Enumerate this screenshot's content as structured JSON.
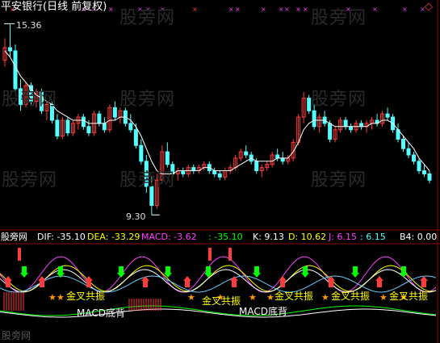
{
  "header": {
    "title": "平安银行(日线 前复权)",
    "marker": "◇"
  },
  "price": {
    "high_label": "15.36",
    "low_label": "9.30"
  },
  "watermark": "股旁网",
  "indicator_bar": {
    "label": "股旁网",
    "dif": "DIF: -35.10",
    "dea": "DEA: -33.29",
    "macd": "MACD: -3.62",
    "extra": ": -35.10",
    "k": "K: 9.13",
    "d": "D: 10.62",
    "j": "J: 6.15",
    "j2": ": 6.15",
    "b4": "B4: 0.00"
  },
  "annotations": {
    "golden_cross": "金叉共振",
    "macd_div": "MACD底背"
  },
  "footer_text": "股旁网",
  "colors": {
    "up": "#ff3c3c",
    "down": "#54ffff",
    "magenta": "#ff40ff",
    "yellow": "#ffff00",
    "green": "#00ff00",
    "orange": "#ff9900",
    "grid_red": "#8a0000"
  },
  "chart_data": {
    "type": "candlestick",
    "ohlc": [
      [
        14.2,
        14.9,
        14.0,
        14.6
      ],
      [
        14.6,
        15.36,
        14.3,
        14.5
      ],
      [
        14.5,
        14.7,
        13.2,
        13.3
      ],
      [
        13.3,
        13.6,
        12.6,
        12.8
      ],
      [
        12.8,
        13.5,
        12.7,
        13.4
      ],
      [
        13.4,
        13.5,
        12.8,
        12.9
      ],
      [
        12.9,
        13.3,
        12.7,
        13.2
      ],
      [
        13.2,
        13.3,
        12.5,
        12.6
      ],
      [
        12.6,
        12.9,
        12.3,
        12.8
      ],
      [
        12.8,
        12.9,
        12.2,
        12.3
      ],
      [
        12.3,
        12.5,
        11.7,
        11.8
      ],
      [
        11.8,
        12.4,
        11.7,
        12.3
      ],
      [
        12.3,
        12.4,
        11.8,
        11.9
      ],
      [
        11.9,
        12.3,
        11.8,
        12.2
      ],
      [
        12.2,
        12.5,
        12.0,
        12.4
      ],
      [
        12.4,
        12.5,
        12.0,
        12.1
      ],
      [
        12.1,
        12.3,
        11.8,
        11.9
      ],
      [
        11.9,
        12.6,
        11.8,
        12.5
      ],
      [
        12.5,
        12.6,
        12.1,
        12.2
      ],
      [
        12.2,
        12.4,
        11.9,
        12.0
      ],
      [
        12.0,
        12.8,
        11.9,
        12.7
      ],
      [
        12.7,
        12.9,
        12.3,
        12.4
      ],
      [
        12.4,
        12.7,
        12.2,
        12.6
      ],
      [
        12.6,
        12.7,
        12.1,
        12.2
      ],
      [
        12.2,
        12.5,
        11.9,
        12.0
      ],
      [
        12.0,
        12.2,
        11.4,
        11.5
      ],
      [
        11.5,
        11.7,
        10.9,
        11.0
      ],
      [
        11.0,
        11.2,
        10.0,
        10.2
      ],
      [
        10.2,
        10.5,
        9.3,
        9.6
      ],
      [
        9.6,
        10.6,
        9.5,
        10.4
      ],
      [
        10.4,
        11.5,
        10.3,
        11.3
      ],
      [
        11.3,
        11.6,
        10.8,
        10.9
      ],
      [
        10.9,
        11.0,
        10.5,
        10.6
      ],
      [
        10.6,
        10.8,
        10.4,
        10.7
      ],
      [
        10.7,
        10.8,
        10.5,
        10.6
      ],
      [
        10.6,
        10.9,
        10.5,
        10.8
      ],
      [
        10.8,
        10.9,
        10.6,
        10.7
      ],
      [
        10.7,
        10.9,
        10.6,
        10.8
      ],
      [
        10.8,
        11.0,
        10.7,
        10.9
      ],
      [
        10.9,
        11.0,
        10.6,
        10.7
      ],
      [
        10.7,
        10.8,
        10.5,
        10.6
      ],
      [
        10.6,
        10.7,
        10.4,
        10.5
      ],
      [
        10.5,
        10.8,
        10.4,
        10.7
      ],
      [
        10.7,
        10.9,
        10.6,
        10.8
      ],
      [
        10.8,
        11.2,
        10.7,
        11.1
      ],
      [
        11.1,
        11.4,
        11.0,
        11.3
      ],
      [
        11.3,
        11.5,
        11.1,
        11.2
      ],
      [
        11.2,
        11.3,
        10.9,
        11.0
      ],
      [
        11.0,
        11.1,
        10.6,
        10.7
      ],
      [
        10.7,
        10.9,
        10.5,
        10.8
      ],
      [
        10.8,
        11.0,
        10.7,
        10.9
      ],
      [
        10.9,
        11.3,
        10.8,
        11.2
      ],
      [
        11.2,
        11.4,
        11.0,
        11.1
      ],
      [
        11.1,
        11.3,
        10.9,
        11.0
      ],
      [
        11.0,
        11.2,
        10.9,
        11.1
      ],
      [
        11.1,
        11.7,
        11.0,
        11.6
      ],
      [
        11.6,
        12.5,
        11.5,
        12.4
      ],
      [
        12.4,
        13.2,
        12.2,
        13.0
      ],
      [
        13.0,
        13.1,
        12.5,
        12.6
      ],
      [
        12.6,
        12.8,
        12.0,
        12.1
      ],
      [
        12.1,
        12.5,
        11.9,
        12.4
      ],
      [
        12.4,
        12.6,
        12.1,
        12.2
      ],
      [
        12.2,
        12.3,
        11.6,
        11.7
      ],
      [
        11.7,
        12.1,
        11.6,
        12.0
      ],
      [
        12.0,
        12.4,
        11.9,
        12.3
      ],
      [
        12.3,
        12.4,
        12.0,
        12.1
      ],
      [
        12.1,
        12.2,
        11.9,
        12.0
      ],
      [
        12.0,
        12.3,
        11.9,
        12.2
      ],
      [
        12.2,
        12.3,
        12.0,
        12.1
      ],
      [
        12.1,
        12.3,
        11.9,
        12.2
      ],
      [
        12.2,
        12.4,
        12.0,
        12.3
      ],
      [
        12.3,
        12.5,
        12.1,
        12.2
      ],
      [
        12.2,
        12.6,
        12.1,
        12.5
      ],
      [
        12.5,
        12.7,
        12.3,
        12.4
      ],
      [
        12.4,
        12.5,
        11.9,
        12.0
      ],
      [
        12.0,
        12.2,
        11.6,
        11.7
      ],
      [
        11.7,
        11.8,
        11.3,
        11.4
      ],
      [
        11.4,
        11.6,
        11.1,
        11.2
      ],
      [
        11.2,
        11.3,
        10.9,
        11.0
      ],
      [
        11.0,
        11.1,
        10.6,
        10.7
      ],
      [
        10.7,
        10.9,
        10.5,
        10.6
      ],
      [
        10.6,
        10.7,
        10.3,
        10.4
      ]
    ],
    "ma": [
      14.5,
      14.3,
      14.0,
      13.7,
      13.5,
      13.3,
      13.1,
      13.0,
      12.9,
      12.8,
      12.6,
      12.5,
      12.4,
      12.3,
      12.3,
      12.3,
      12.2,
      12.2,
      12.2,
      12.2,
      12.3,
      12.3,
      12.4,
      12.4,
      12.3,
      12.1,
      11.8,
      11.4,
      11.0,
      10.7,
      10.6,
      10.6,
      10.6,
      10.7,
      10.7,
      10.7,
      10.7,
      10.7,
      10.8,
      10.8,
      10.7,
      10.7,
      10.7,
      10.7,
      10.8,
      10.9,
      11.0,
      11.1,
      11.0,
      11.0,
      11.0,
      11.0,
      11.1,
      11.1,
      11.1,
      11.3,
      11.6,
      12.0,
      12.2,
      12.3,
      12.3,
      12.3,
      12.2,
      12.1,
      12.1,
      12.1,
      12.1,
      12.1,
      12.1,
      12.1,
      12.2,
      12.2,
      12.3,
      12.3,
      12.2,
      12.0,
      11.8,
      11.6,
      11.4,
      11.1,
      10.9,
      10.7
    ],
    "ylim": [
      9.0,
      15.6
    ]
  }
}
